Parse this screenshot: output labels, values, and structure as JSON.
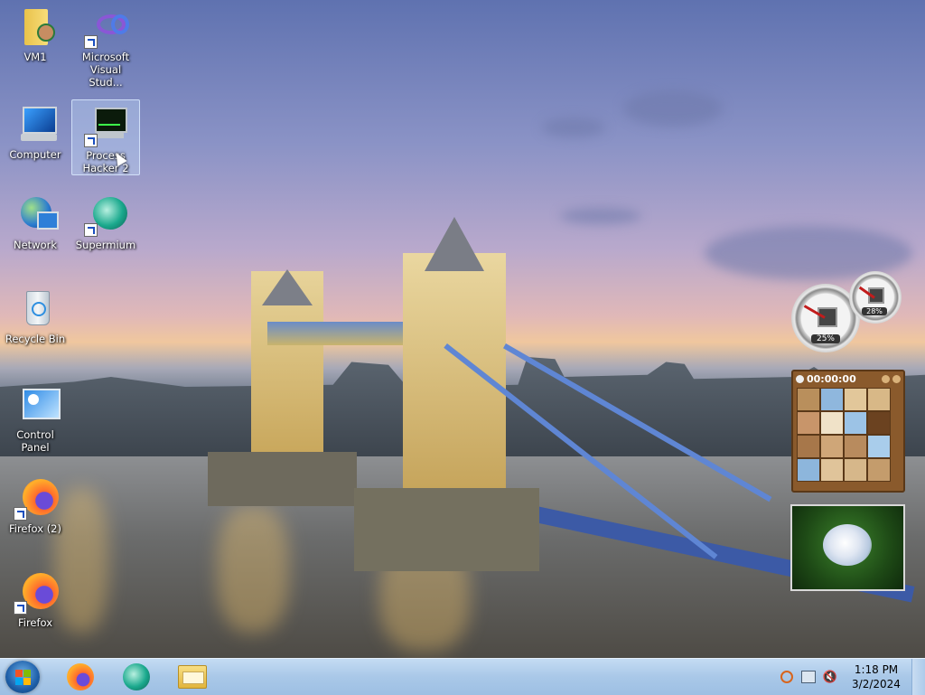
{
  "desktop": {
    "icons": [
      {
        "name": "vm1-icon",
        "label": "VM1"
      },
      {
        "name": "visual-studio-icon",
        "label": "Microsoft Visual Stud..."
      },
      {
        "name": "computer-icon",
        "label": "Computer"
      },
      {
        "name": "process-hacker-icon",
        "label": "Process Hacker 2"
      },
      {
        "name": "network-icon",
        "label": "Network"
      },
      {
        "name": "supermium-icon",
        "label": "Supermium"
      },
      {
        "name": "recycle-bin-icon",
        "label": "Recycle Bin"
      },
      {
        "name": "control-panel-icon",
        "label": "Control Panel"
      },
      {
        "name": "firefox-icon",
        "label": "Firefox (2)"
      },
      {
        "name": "firefox-icon",
        "label": "Firefox"
      }
    ]
  },
  "gadgets": {
    "cpu_meter": {
      "cpu_percent": "25%",
      "memory_percent": "28%"
    },
    "puzzle": {
      "timer": "00:00:00"
    }
  },
  "taskbar": {
    "pinned": [
      "firefox-icon",
      "supermium-icon",
      "file-explorer-icon"
    ],
    "tray_icons": [
      "search-icon",
      "network-icon",
      "volume-muted-icon"
    ],
    "time": "1:18 PM",
    "date": "3/2/2024"
  },
  "colors": {
    "taskbar": "#a9c8e8",
    "accent": "#1e5fa9"
  }
}
